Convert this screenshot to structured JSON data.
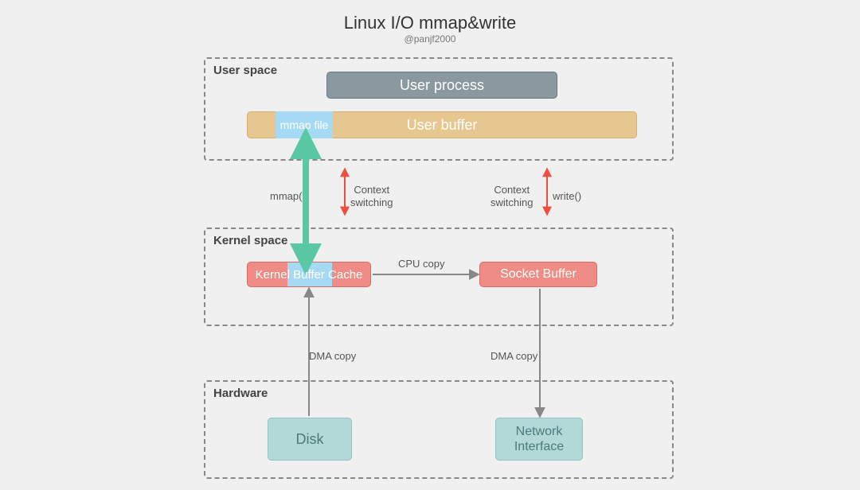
{
  "title": "Linux I/O mmap&write",
  "subtitle": "@panjf2000",
  "sections": {
    "user": {
      "label": "User space"
    },
    "kernel": {
      "label": "Kernel space"
    },
    "hw": {
      "label": "Hardware"
    }
  },
  "boxes": {
    "user_process": "User process",
    "mmap_file": "mmap file",
    "user_buffer": "User buffer",
    "kbc": "Kernel Buffer Cache",
    "socket": "Socket Buffer",
    "disk": "Disk",
    "nic_l1": "Network",
    "nic_l2": "Interface"
  },
  "labels": {
    "mmap_call": "mmap()",
    "ctx1": "Context\nswitching",
    "ctx2": "Context\nswitching",
    "write_call": "write()",
    "cpu_copy": "CPU copy",
    "dma1": "DMA copy",
    "dma2": "DMA copy"
  }
}
